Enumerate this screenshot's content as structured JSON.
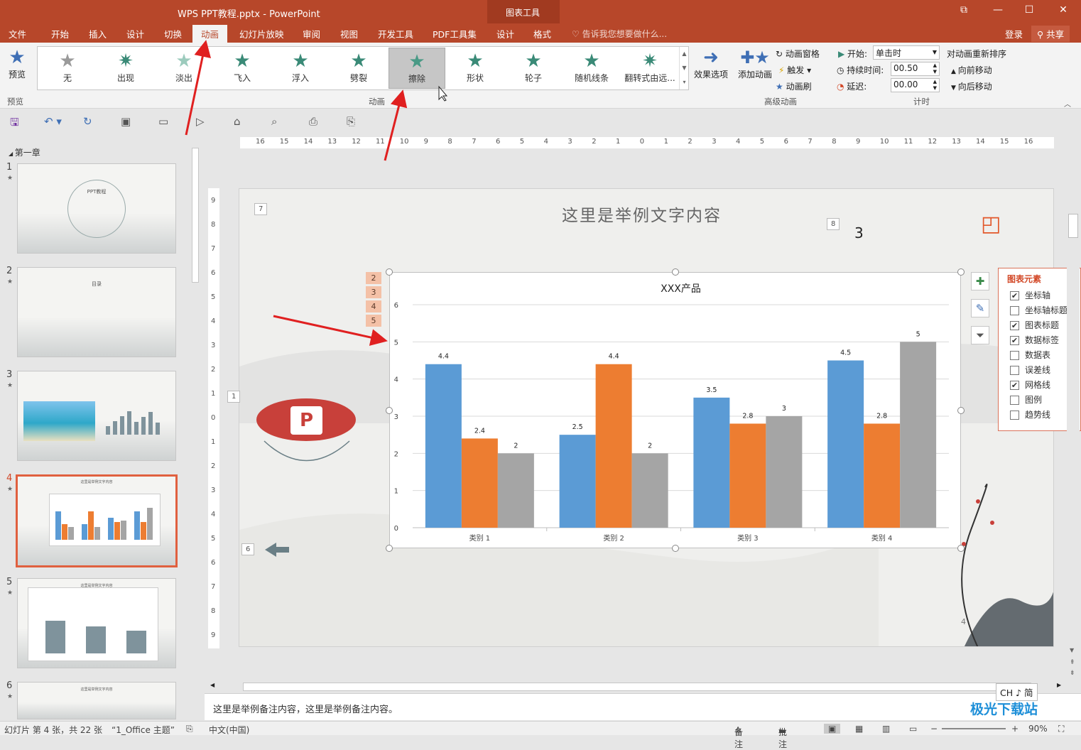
{
  "window": {
    "title": "WPS PPT教程.pptx - PowerPoint",
    "chart_tools": "图表工具"
  },
  "tabs": {
    "file": "文件",
    "home": "开始",
    "insert": "插入",
    "design": "设计",
    "transitions": "切换",
    "animations": "动画",
    "slideshow": "幻灯片放映",
    "review": "审阅",
    "view": "视图",
    "developer": "开发工具",
    "pdf": "PDF工具集",
    "chart_design": "设计",
    "chart_format": "格式"
  },
  "tell_me": "告诉我您想要做什么...",
  "login": "登录",
  "share": "共享",
  "ribbon": {
    "preview": "预览",
    "preview_group": "预览",
    "animations": [
      {
        "label": "无",
        "color": "#9a9a9a",
        "glyph": "★"
      },
      {
        "label": "出现",
        "color": "#3a8a77",
        "glyph": "✷"
      },
      {
        "label": "淡出",
        "color": "#9ccbbd",
        "glyph": "★"
      },
      {
        "label": "飞入",
        "color": "#3a8a77",
        "glyph": "★"
      },
      {
        "label": "浮入",
        "color": "#3a8a77",
        "glyph": "★"
      },
      {
        "label": "劈裂",
        "color": "#3a8a77",
        "glyph": "★"
      },
      {
        "label": "擦除",
        "color": "#4a9a86",
        "glyph": "★"
      },
      {
        "label": "形状",
        "color": "#3a8a77",
        "glyph": "★"
      },
      {
        "label": "轮子",
        "color": "#3a8a77",
        "glyph": "★"
      },
      {
        "label": "随机线条",
        "color": "#3a8a77",
        "glyph": "★"
      },
      {
        "label": "翻转式由远...",
        "color": "#3a8a77",
        "glyph": "✷"
      }
    ],
    "animation_group": "动画",
    "effect_options": "效果选项",
    "add_animation": "添加动画",
    "animation_pane": "动画窗格",
    "trigger": "触发",
    "animation_painter": "动画刷",
    "advanced_group": "高级动画",
    "start_label": "开始:",
    "start_value": "单击时",
    "duration_label": "持续时间:",
    "duration_value": "00.50",
    "delay_label": "延迟:",
    "delay_value": "00.00",
    "timing_group": "计时",
    "reorder": "对动画重新排序",
    "move_earlier": "向前移动",
    "move_later": "向后移动"
  },
  "thumbs": {
    "chapter": "第一章",
    "slides": [
      {
        "num": "1",
        "title": "PPT教程"
      },
      {
        "num": "2",
        "title": "目录"
      },
      {
        "num": "3",
        "title": ""
      },
      {
        "num": "4",
        "title": "这里是举例文字内容"
      },
      {
        "num": "5",
        "title": "这里是举例文字内容"
      },
      {
        "num": "6",
        "title": "这里是举例文字内容"
      }
    ]
  },
  "slide": {
    "title": "这里是举例文字内容",
    "big_number": "3",
    "page_no": "4",
    "tags": {
      "t7": "7",
      "t8": "8",
      "t1": "1",
      "t6": "6"
    },
    "order_tags": [
      "2",
      "3",
      "4",
      "5"
    ]
  },
  "chart_data": {
    "type": "bar",
    "title": "XXX产品",
    "categories": [
      "类别 1",
      "类别 2",
      "类别 3",
      "类别 4"
    ],
    "series": [
      {
        "values": [
          4.4,
          2.5,
          3.5,
          4.5
        ],
        "color": "#5b9bd5"
      },
      {
        "values": [
          2.4,
          4.4,
          2.8,
          2.8
        ],
        "color": "#ed7d31"
      },
      {
        "values": [
          2,
          2,
          3,
          5
        ],
        "color": "#a5a5a5"
      }
    ],
    "ylim": [
      0,
      6
    ],
    "yticks": [
      "0",
      "1",
      "2",
      "3",
      "4",
      "5",
      "6"
    ],
    "grid": true,
    "legend": false,
    "data_labels": true
  },
  "chart_elements": {
    "header": "图表元素",
    "items": [
      {
        "label": "坐标轴",
        "checked": true
      },
      {
        "label": "坐标轴标题",
        "checked": false
      },
      {
        "label": "图表标题",
        "checked": true
      },
      {
        "label": "数据标签",
        "checked": true
      },
      {
        "label": "数据表",
        "checked": false
      },
      {
        "label": "误差线",
        "checked": false
      },
      {
        "label": "网格线",
        "checked": true
      },
      {
        "label": "图例",
        "checked": false
      },
      {
        "label": "趋势线",
        "checked": false
      }
    ]
  },
  "notes": "这里是举例备注内容，这里是举例备注内容。",
  "status": {
    "slide_info": "幻灯片 第 4 张，共 22 张",
    "theme": "“1_Office 主题”",
    "language": "中文(中国)",
    "notes_btn": "备注",
    "comments_btn": "批注",
    "zoom": "90%"
  },
  "ime": "CH ♪ 简",
  "watermark": "极光下载站"
}
